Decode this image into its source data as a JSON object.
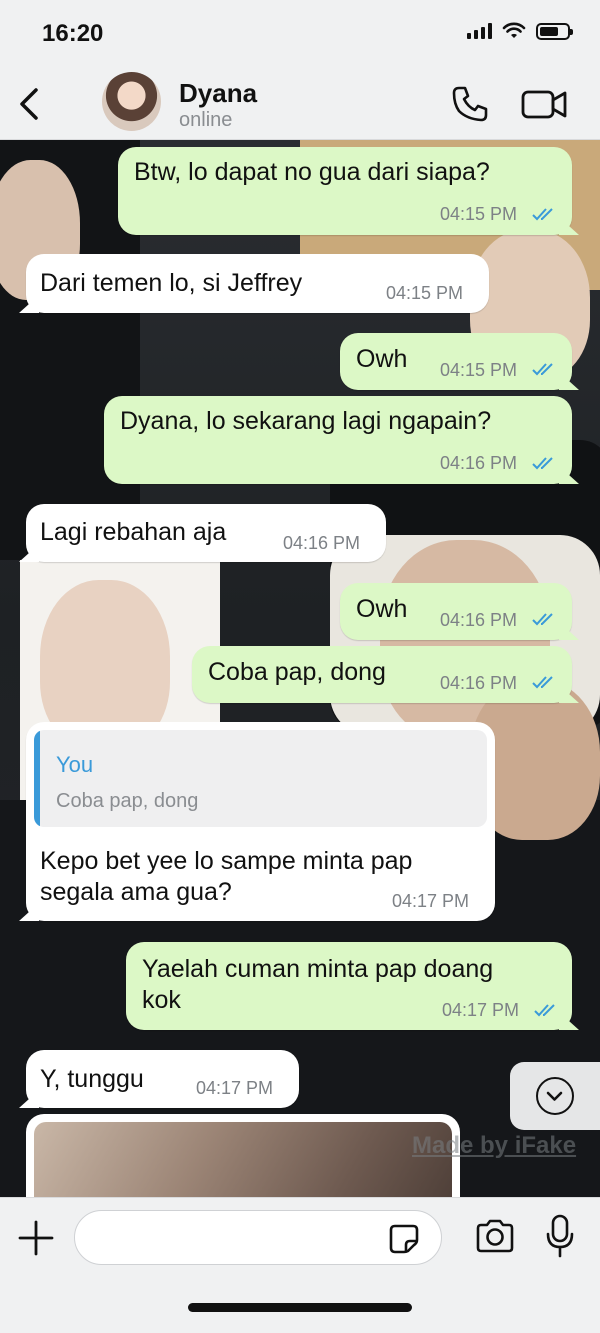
{
  "status_bar": {
    "time": "16:20",
    "battery_level_pct": 70
  },
  "header": {
    "contact_name": "Dyana",
    "contact_status": "online"
  },
  "messages": [
    {
      "dir": "out",
      "text": "Btw, lo dapat no gua dari siapa?",
      "time": "04:15 PM",
      "read": true
    },
    {
      "dir": "in",
      "text": "Dari temen lo, si Jeffrey",
      "time": "04:15 PM"
    },
    {
      "dir": "out",
      "text": "Owh",
      "time": "04:15 PM",
      "read": true
    },
    {
      "dir": "out",
      "text": "Dyana, lo sekarang lagi ngapain?",
      "time": "04:16 PM",
      "read": true
    },
    {
      "dir": "in",
      "text": "Lagi rebahan aja",
      "time": "04:16 PM"
    },
    {
      "dir": "out",
      "text": "Owh",
      "time": "04:16 PM",
      "read": true
    },
    {
      "dir": "out",
      "text": "Coba pap, dong",
      "time": "04:16 PM",
      "read": true
    },
    {
      "dir": "in",
      "reply_author": "You",
      "reply_text": "Coba pap, dong",
      "text_line1": "Kepo bet yee lo sampe minta pap",
      "text_line2": "segala ama gua?",
      "time": "04:17 PM"
    },
    {
      "dir": "out",
      "text_line1": "Yaelah cuman minta pap doang",
      "text_line2": "kok",
      "time": "04:17 PM",
      "read": true
    },
    {
      "dir": "in",
      "text": "Y, tunggu",
      "time": "04:17 PM"
    }
  ],
  "watermark": "Made by iFake",
  "input": {
    "placeholder": ""
  },
  "icons": {
    "back": "chevron-left-icon",
    "call": "phone-icon",
    "video": "video-camera-icon",
    "read_receipt": "double-check-icon",
    "scroll_down": "chevron-down-icon",
    "attach": "plus-icon",
    "sticker": "sticker-icon",
    "camera": "camera-icon",
    "mic": "microphone-icon"
  },
  "colors": {
    "outgoing_bubble": "#dcf8c6",
    "incoming_bubble": "#ffffff",
    "read_tick": "#3a9ad9",
    "reply_accent": "#3a9ad9",
    "bar_background": "#f0f1f2"
  }
}
